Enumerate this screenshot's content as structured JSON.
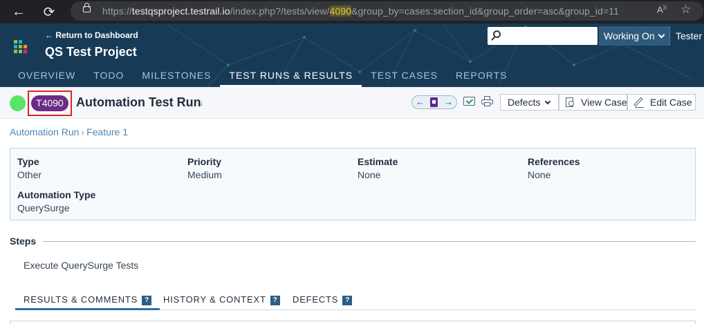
{
  "browser": {
    "url_scheme": "https://",
    "url_host": "testqsproject.testrail.io",
    "url_before_highlight": "/index.php?/tests/view/",
    "url_highlight": "4090",
    "url_after_highlight": "&group_by=cases:section_id&group_order=asc&group_id=11"
  },
  "header": {
    "back_link": "← Return to Dashboard",
    "project_title": "QS Test Project",
    "search_placeholder": "",
    "working_on": "Working On",
    "user": "Tester",
    "tabs": [
      {
        "label": "OVERVIEW",
        "active": false
      },
      {
        "label": "TODO",
        "active": false
      },
      {
        "label": "MILESTONES",
        "active": false
      },
      {
        "label": "TEST RUNS & RESULTS",
        "active": true
      },
      {
        "label": "TEST CASES",
        "active": false
      },
      {
        "label": "REPORTS",
        "active": false
      }
    ]
  },
  "test": {
    "id": "T4090",
    "title": "Automation Test Run",
    "status_color": "#59e467",
    "badge_color": "#6d2a86"
  },
  "toolbar": {
    "defects_label": "Defects",
    "view_case_label": "View Case",
    "edit_case_label": "Edit Case"
  },
  "breadcrumb": {
    "run": "Automation Run",
    "separator": "›",
    "section": "Feature 1"
  },
  "fields": [
    {
      "label": "Type",
      "value": "Other"
    },
    {
      "label": "Priority",
      "value": "Medium"
    },
    {
      "label": "Estimate",
      "value": "None"
    },
    {
      "label": "References",
      "value": "None"
    },
    {
      "label": "Automation Type",
      "value": "QuerySurge"
    }
  ],
  "steps": {
    "title": "Steps",
    "text": "Execute QuerySurge Tests"
  },
  "sub_tabs": [
    {
      "label": "RESULTS & COMMENTS",
      "active": true
    },
    {
      "label": "HISTORY & CONTEXT",
      "active": false
    },
    {
      "label": "DEFECTS",
      "active": false
    }
  ],
  "help_badge": "?"
}
